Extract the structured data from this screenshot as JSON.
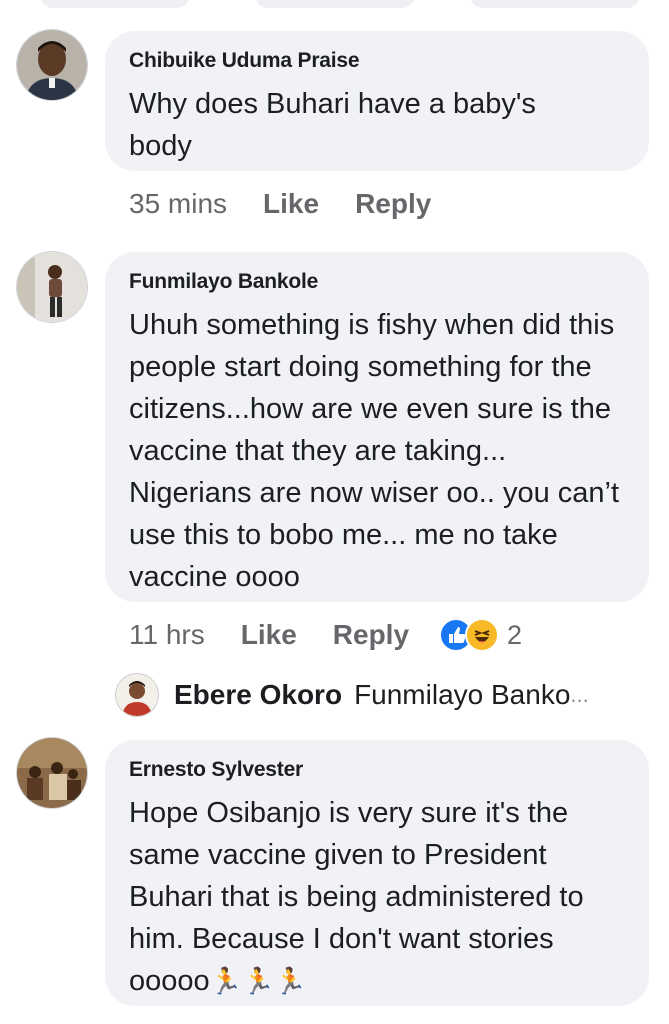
{
  "comments": [
    {
      "author": "Chibuike Uduma Praise",
      "text": "Why does Buhari have a baby's body",
      "time": "35 mins",
      "like_label": "Like",
      "reply_label": "Reply"
    },
    {
      "author": "Funmilayo Bankole",
      "text": "Uhuh something is fishy when did this people start doing something for the citizens...how are we even sure is the vaccine that they are taking... Nigerians are now wiser oo.. you can’t use this to bobo me... me no take vaccine oooo",
      "time": "11 hrs",
      "like_label": "Like",
      "reply_label": "Reply",
      "reactions": {
        "icons": [
          "like-reaction-icon",
          "haha-reaction-icon"
        ],
        "count": "2"
      }
    },
    {
      "author": "Ernesto Sylvester",
      "text": "Hope Osibanjo is very sure it's the same vaccine given to President Buhari that is being administered to him. Because I don't want stories ooooo",
      "emoji": "🏃🏃🏃"
    }
  ],
  "reply_preview": {
    "author": "Ebere Okoro",
    "snippet": "Funmilayo Banko",
    "ellipsis": "..."
  },
  "colors": {
    "bubble": "#f0f2f5",
    "meta_text": "#65676b",
    "like_blue": "#1877f2",
    "haha_yellow": "#f7b928"
  }
}
